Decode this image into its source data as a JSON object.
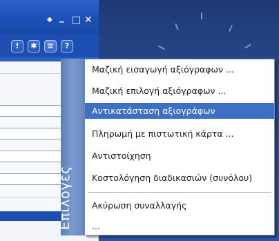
{
  "window_controls": {
    "pin": "◆",
    "minimize": "_",
    "maximize": "□",
    "close": "✕"
  },
  "toolbar": {
    "buttons": [
      {
        "icon": "info-icon",
        "glyph": "!"
      },
      {
        "icon": "gear-icon",
        "glyph": "✱"
      },
      {
        "icon": "menu-icon",
        "glyph": "≡"
      },
      {
        "icon": "help-icon",
        "glyph": "?"
      }
    ]
  },
  "menu": {
    "caption": "Επιλογές",
    "highlighted_index": 2,
    "items": [
      {
        "label": "Μαζική εισαγωγή αξιόγραφων ..."
      },
      {
        "label": "Μαζική επιλογή αξιόγραφων ..."
      },
      {
        "label": "Αντικατάσταση αξιογράφων"
      },
      {
        "label": "Πληρωμή με πιστωτική κάρτα ..."
      },
      {
        "label": "Αντιστοίχηση"
      },
      {
        "label": "Κοστολόγηση διαδικασιών (συνόλου)"
      },
      {
        "label": "Ακύρωση συναλλαγής"
      },
      {
        "label": "..."
      }
    ]
  },
  "colors": {
    "accent": "#3d6fc4",
    "titlebar": "#1c4fb4",
    "background_panel": "#264a8c"
  }
}
